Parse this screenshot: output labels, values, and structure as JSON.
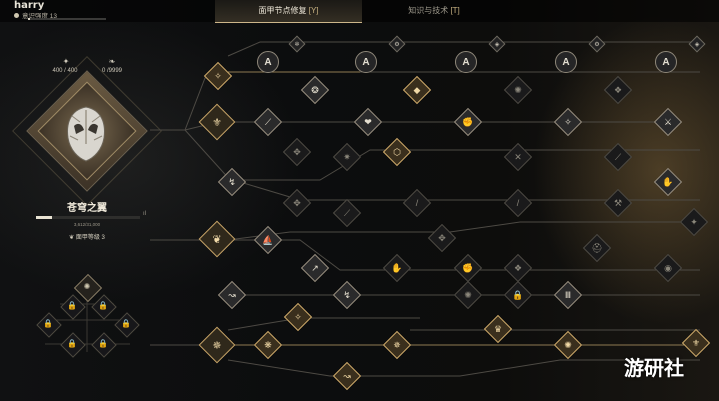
{
  "player": {
    "name": "harry",
    "intensity_label": "意识强度 13",
    "intensity_progress": 0.03
  },
  "tabs": [
    {
      "label": "面甲节点修复",
      "key": "[Y]",
      "active": true
    },
    {
      "label": "知识与技术",
      "key": "[T]",
      "active": false
    }
  ],
  "stats": {
    "left": "400 / 400",
    "right": "0 /9999"
  },
  "armor": {
    "name": "苍穹之翼",
    "xp_text": "3,612/31,000",
    "xp_progress": 0.15,
    "level_label": "面甲等级 3",
    "signal": "ıl"
  },
  "watermark": "游研社",
  "colors": {
    "gold": "#d2ad6c",
    "line": "#5a5650",
    "text": "#e6e0d0"
  }
}
